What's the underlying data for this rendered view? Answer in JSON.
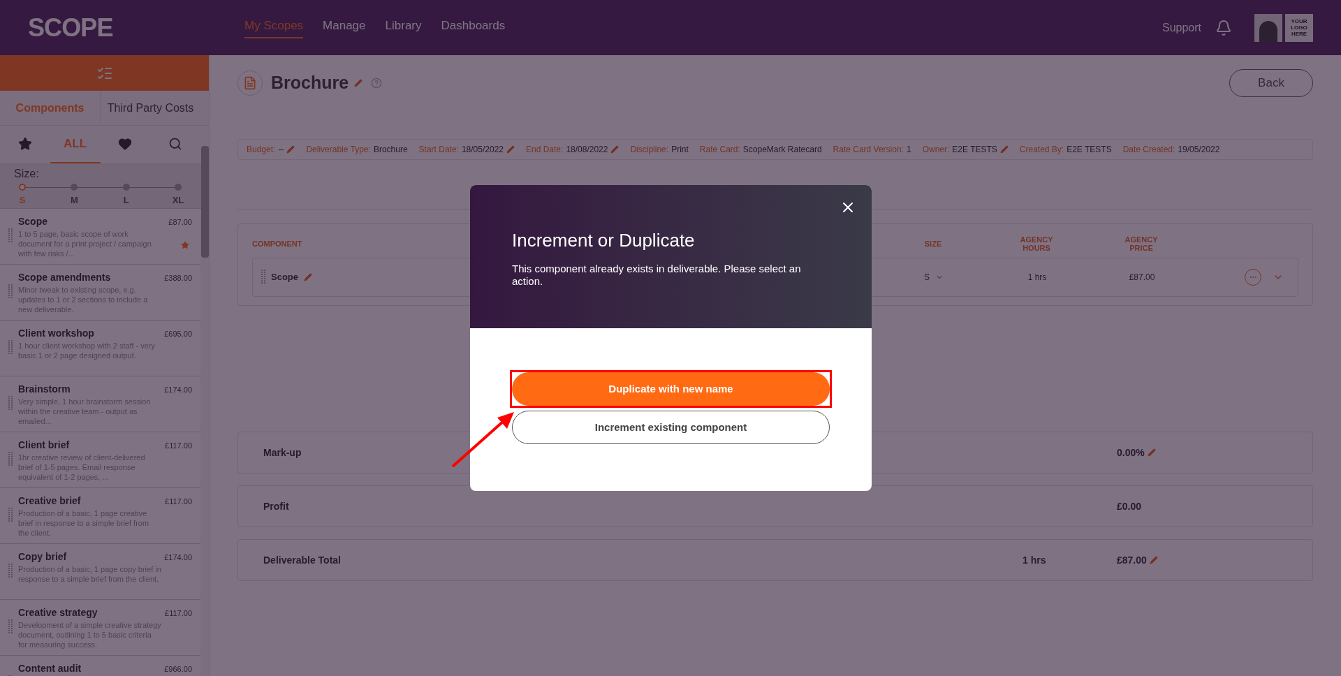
{
  "header": {
    "logo": "SCOPE",
    "nav": [
      {
        "label": "My Scopes",
        "selected": true
      },
      {
        "label": "Manage",
        "selected": false
      },
      {
        "label": "Library",
        "selected": false
      },
      {
        "label": "Dashboards",
        "selected": false
      }
    ],
    "support": "Support",
    "brand_logo": "YOUR LOGO HERE"
  },
  "sidebar": {
    "tabs": [
      {
        "label": "Components",
        "selected": true
      },
      {
        "label": "Third Party Costs",
        "selected": false
      }
    ],
    "filters": [
      {
        "kind": "star",
        "selected": false
      },
      {
        "kind": "text",
        "label": "ALL",
        "selected": true
      },
      {
        "kind": "heart",
        "selected": false
      },
      {
        "kind": "search",
        "selected": false
      }
    ],
    "size_label": "Size:",
    "sizes": [
      {
        "label": "S",
        "selected": true
      },
      {
        "label": "M",
        "selected": false
      },
      {
        "label": "L",
        "selected": false
      },
      {
        "label": "XL",
        "selected": false
      }
    ],
    "items": [
      {
        "name": "Scope",
        "price": "£87.00",
        "description": "1 to 5 page, basic scope of work document for a print project / campaign with few risks /...",
        "starred": true
      },
      {
        "name": "Scope amendments",
        "price": "£388.00",
        "description": "Minor tweak to existing scope, e.g. updates to 1 or 2 sections to include a new deliverable.",
        "starred": false
      },
      {
        "name": "Client workshop",
        "price": "£695.00",
        "description": "1 hour client workshop with 2 staff - very basic 1 or 2 page designed output.",
        "starred": false
      },
      {
        "name": "Brainstorm",
        "price": "£174.00",
        "description": "Very simple, 1 hour brainstorm session within the creative team - output as emailed...",
        "starred": false
      },
      {
        "name": "Client brief",
        "price": "£117.00",
        "description": "1hr creative review of client-delivered brief of 1-5 pages. Email response equivalent of 1-2 pages, ...",
        "starred": false
      },
      {
        "name": "Creative brief",
        "price": "£117.00",
        "description": "Production of a basic, 1 page creative brief in response to a simple brief from the client.",
        "starred": false
      },
      {
        "name": "Copy brief",
        "price": "£174.00",
        "description": "Production of a basic, 1 page copy brief in response to a simple brief from the client.",
        "starred": false
      },
      {
        "name": "Creative strategy",
        "price": "£117.00",
        "description": "Development of a simple creative strategy document, outlining 1 to 5 basic criteria for measuring success.",
        "starred": false
      },
      {
        "name": "Content audit",
        "price": "£966.00",
        "starred": false
      }
    ]
  },
  "deliverable": {
    "title": "Brochure",
    "back": "Back",
    "meta": [
      {
        "label": "Budget:",
        "value": "--",
        "editable": true
      },
      {
        "label": "Deliverable Type:",
        "value": "Brochure",
        "editable": false
      },
      {
        "label": "Start Date:",
        "value": "18/05/2022",
        "editable": true
      },
      {
        "label": "End Date:",
        "value": "18/08/2022",
        "editable": true
      },
      {
        "label": "Discipline:",
        "value": "Print",
        "editable": false
      },
      {
        "label": "Rate Card:",
        "value": "ScopeMark Ratecard",
        "editable": false
      },
      {
        "label": "Rate Card Version:",
        "value": "1",
        "editable": false
      },
      {
        "label": "Owner:",
        "value": "E2E TESTS",
        "editable": true
      },
      {
        "label": "Created By:",
        "value": "E2E TESTS",
        "editable": false
      },
      {
        "label": "Date Created:",
        "value": "19/05/2022",
        "editable": false
      }
    ]
  },
  "table": {
    "columns": [
      "COMPONENT",
      "SIZE",
      "AGENCY HOURS",
      "AGENCY PRICE"
    ],
    "rows": [
      {
        "component": "Scope",
        "size": "S",
        "hours": "1 hrs",
        "price": "£87.00"
      }
    ]
  },
  "totals": [
    {
      "label": "Mark-up",
      "value": "0.00%",
      "editable": true
    },
    {
      "label": "Profit",
      "value": "£0.00",
      "editable": false
    },
    {
      "label": "Deliverable Total",
      "hours": "1 hrs",
      "value": "£87.00",
      "editable": true
    }
  ],
  "dialog": {
    "title": "Increment or Duplicate",
    "message": "This component already exists in deliverable. Please select an action.",
    "actions": [
      {
        "label": "Duplicate with new name",
        "kind": "primary",
        "highlighted": true
      },
      {
        "label": "Increment existing component",
        "kind": "secondary",
        "highlighted": false
      }
    ]
  }
}
